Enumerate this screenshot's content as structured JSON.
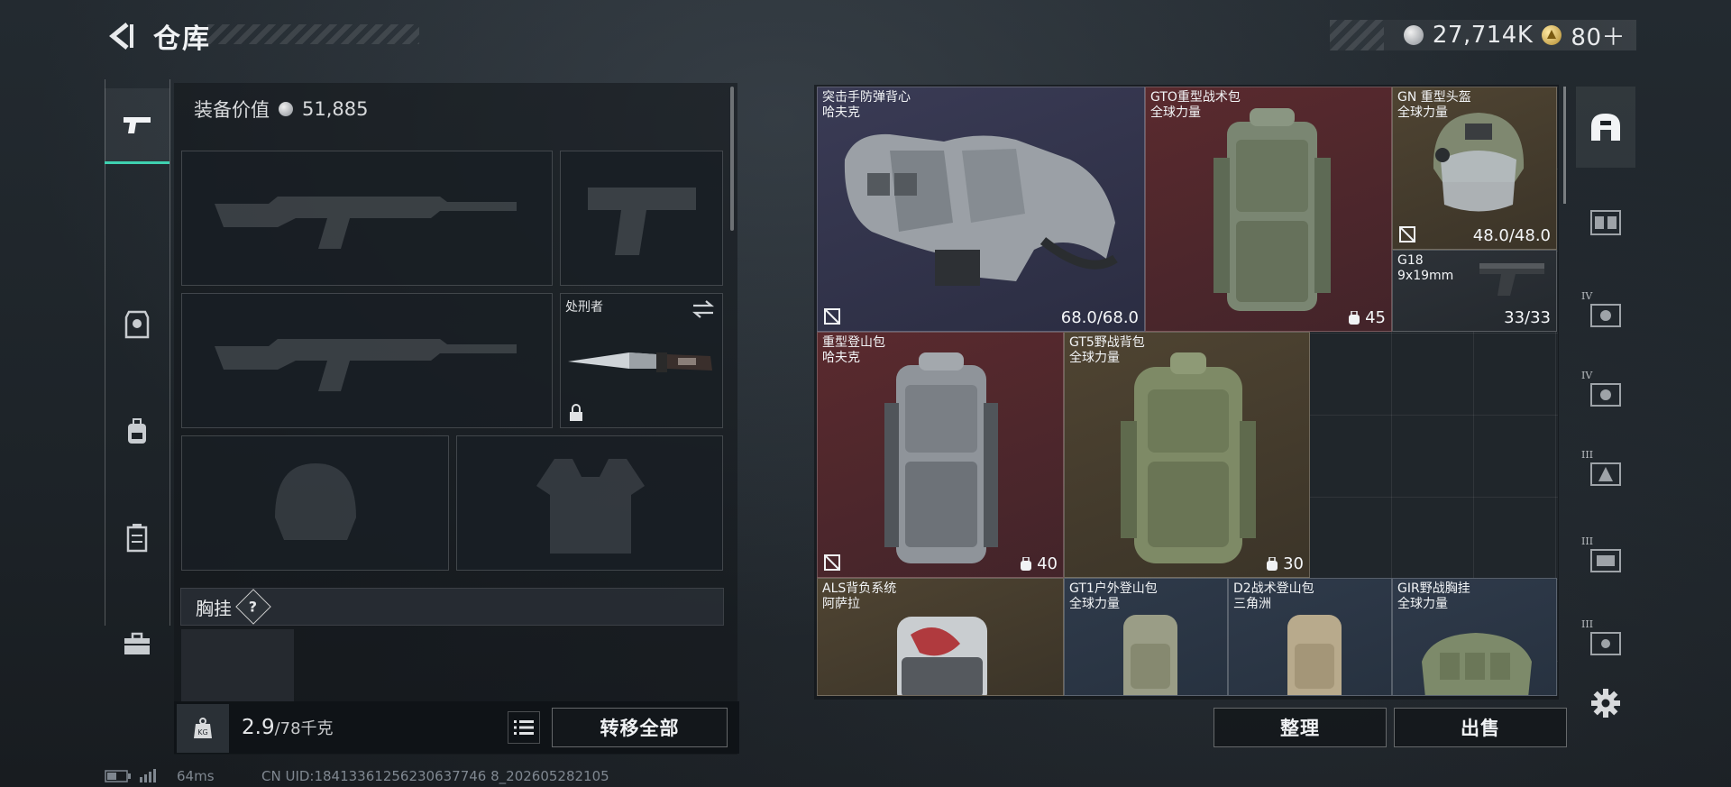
{
  "header": {
    "title": "仓库",
    "currency_silver": "27,714K",
    "currency_gold": "80＋"
  },
  "loadout": {
    "equip_value_label": "装备价值",
    "equip_value": "51,885",
    "melee_label": "处刑者",
    "chest_rig_label": "胸挂",
    "chest_rig_help": "?",
    "weight_current": "2.9",
    "weight_max": "/78千克",
    "transfer_all": "转移全部"
  },
  "stash": {
    "items": [
      {
        "name1": "突击手防弹背心",
        "name2": "哈夫克",
        "stat": "68.0/68.0",
        "rarity": "purple"
      },
      {
        "name1": "GTO重型战术包",
        "name2": "全球力量",
        "stat": "45",
        "rarity": "red"
      },
      {
        "name1": "GN 重型头盔",
        "name2": "全球力量",
        "stat": "48.0/48.0",
        "rarity": "brown"
      },
      {
        "name1": "G18",
        "name2": "9x19mm",
        "stat": "33/33",
        "rarity": "dark"
      },
      {
        "name1": "重型登山包",
        "name2": "哈夫克",
        "stat": "40",
        "rarity": "red"
      },
      {
        "name1": "GT5野战背包",
        "name2": "全球力量",
        "stat": "30",
        "rarity": "brown"
      },
      {
        "name1": "ALS背负系统",
        "name2": "阿萨拉",
        "stat": "",
        "rarity": "brown"
      },
      {
        "name1": "GT1户外登山包",
        "name2": "全球力量",
        "stat": "",
        "rarity": "blue"
      },
      {
        "name1": "D2战术登山包",
        "name2": "三角洲",
        "stat": "",
        "rarity": "blue"
      },
      {
        "name1": "GIR野战胸挂",
        "name2": "全球力量",
        "stat": "",
        "rarity": "blue"
      }
    ],
    "sort_button": "整理",
    "sell_button": "出售"
  },
  "right_tabs": [
    {
      "icon": "helmet-category-icon",
      "tier": ""
    },
    {
      "icon": "vest-category-icon",
      "tier": ""
    },
    {
      "icon": "tier4-armor-icon",
      "tier": "IV"
    },
    {
      "icon": "tier4-armor-icon",
      "tier": "IV"
    },
    {
      "icon": "tier3-armor-icon",
      "tier": "III"
    },
    {
      "icon": "tier3-armor-icon",
      "tier": "III"
    },
    {
      "icon": "tier3-armor-icon",
      "tier": "III"
    },
    {
      "icon": "settings-icon",
      "tier": ""
    }
  ],
  "status": {
    "ping": "64ms",
    "uid": "CN UID:18413361256230637746 8_202605282105"
  },
  "colors": {
    "accent": "#3fd1b0",
    "purple": "#3a3b55",
    "red": "#5a2a2e",
    "brown": "#4f4432",
    "blue": "#2f3a4a"
  }
}
